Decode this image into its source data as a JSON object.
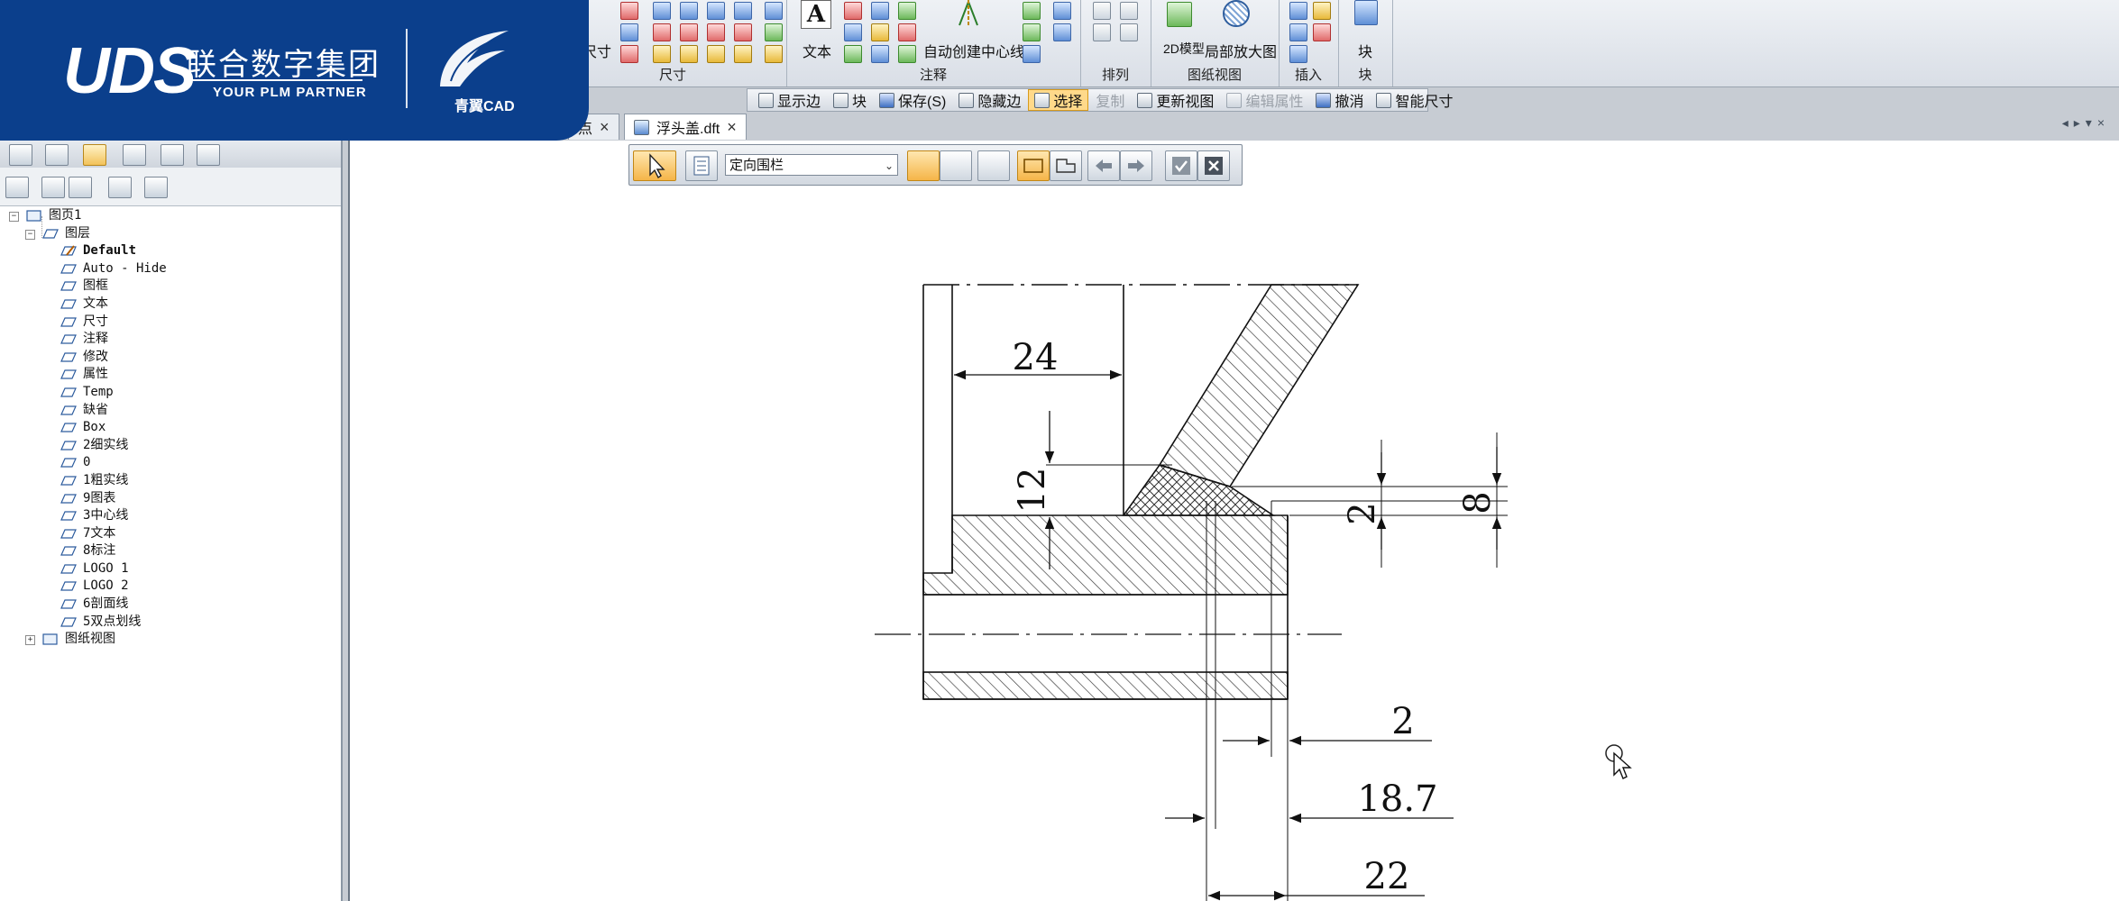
{
  "ribbon": {
    "groups": [
      {
        "label": "尺寸",
        "button": "尺寸"
      },
      {
        "label": "注释",
        "text_button": "文本",
        "center_line_button": "自动创建中心线"
      },
      {
        "label": "排列"
      },
      {
        "label": "图纸视图",
        "model_button": "2D模型",
        "detail_button": "局部放大图"
      },
      {
        "label": "插入"
      },
      {
        "label": "块",
        "block_button": "块"
      }
    ]
  },
  "toolbar_strip": {
    "items": [
      {
        "label": "显示边",
        "state": "normal"
      },
      {
        "label": "块",
        "state": "normal"
      },
      {
        "label": "保存(S)",
        "state": "normal"
      },
      {
        "label": "隐藏边",
        "state": "normal"
      },
      {
        "label": "选择",
        "state": "active"
      },
      {
        "label": "复制",
        "state": "disabled"
      },
      {
        "label": "更新视图",
        "state": "normal"
      },
      {
        "label": "编辑属性",
        "state": "disabled"
      },
      {
        "label": "撤消",
        "state": "normal"
      },
      {
        "label": "智能尺寸",
        "state": "normal"
      }
    ]
  },
  "logo": {
    "brand": "UDS",
    "company": "联合数字集团",
    "tagline": "YOUR PLM PARTNER",
    "product": "青翼CAD"
  },
  "document_tabs": [
    {
      "label": "点",
      "active": false
    },
    {
      "label": "浮头盖.dft",
      "active": true
    }
  ],
  "select_bar": {
    "dropdown_value": "定向围栏"
  },
  "tree": {
    "root": "图页1",
    "layers_node": "图层",
    "layers": [
      "Default",
      "Auto - Hide",
      "图框",
      "文本",
      "尺寸",
      "注释",
      "修改",
      "属性",
      "Temp",
      "缺省",
      "Box",
      "2细实线",
      "0",
      "1粗实线",
      "9图表",
      "3中心线",
      "7文本",
      "8标注",
      "LOGO 1",
      "LOGO 2",
      "6剖面线",
      "5双点划线"
    ],
    "views_node": "图纸视图"
  },
  "drawing": {
    "dimensions": [
      "24",
      "12",
      "2",
      "8",
      "2",
      "18.7",
      "22"
    ]
  },
  "colors": {
    "logo_bg": "#0b3f8c",
    "sheet": "#ffffff",
    "active_tool": "#ffd98a"
  }
}
